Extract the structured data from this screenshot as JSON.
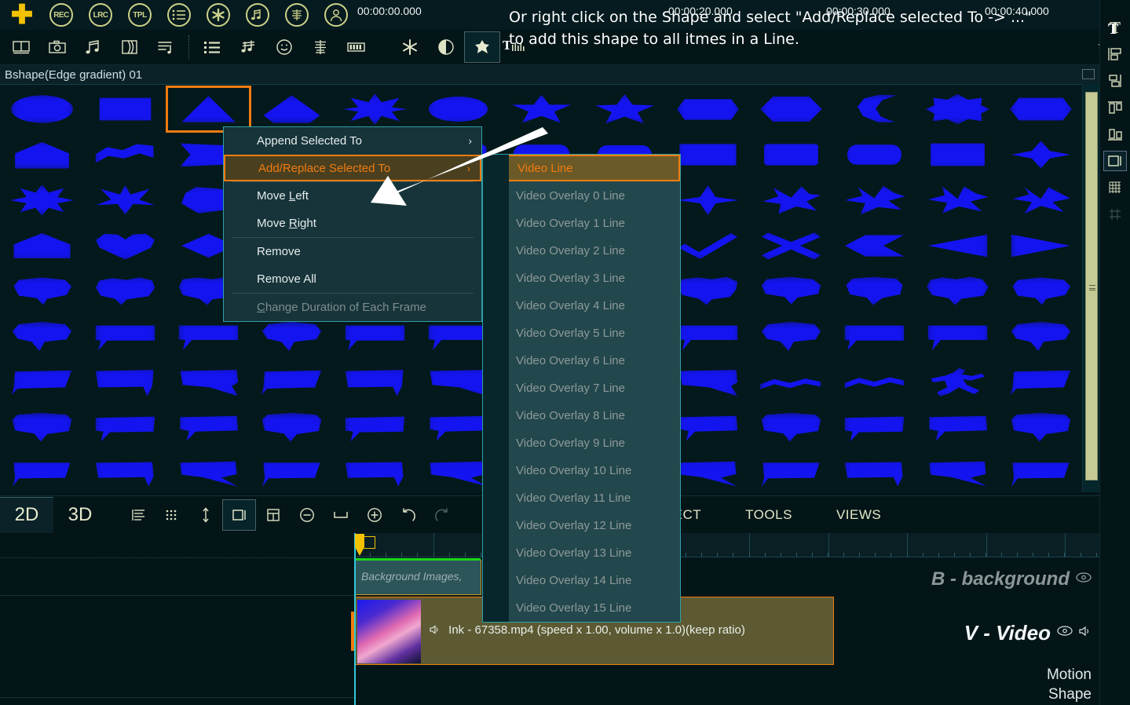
{
  "app": {
    "title": "Bshape(Edge gradient) 01"
  },
  "toolbar_primary": [
    {
      "name": "add-button",
      "label": "+",
      "type": "plus"
    },
    {
      "name": "record-button",
      "label": "REC",
      "type": "circle"
    },
    {
      "name": "lyrics-button",
      "label": "LRC",
      "type": "circle"
    },
    {
      "name": "template-button",
      "label": "TPL",
      "type": "circle"
    },
    {
      "name": "list-button",
      "label": "list-icon",
      "type": "circle-icon"
    },
    {
      "name": "asterisk-button",
      "label": "asterisk-icon",
      "type": "circle-icon"
    },
    {
      "name": "music-note-button",
      "label": "music-note-icon",
      "type": "circle-icon"
    },
    {
      "name": "equalizer-button",
      "label": "equalizer-icon",
      "type": "circle-icon"
    },
    {
      "name": "user-button",
      "label": "user-icon",
      "type": "circle-icon"
    }
  ],
  "toolbar_secondary": [
    {
      "name": "filmstrip-icon",
      "selected": false
    },
    {
      "name": "camera-icon",
      "selected": false
    },
    {
      "name": "music-notes-icon",
      "selected": false
    },
    {
      "name": "transition-icon",
      "selected": false
    },
    {
      "name": "playlist-note-icon",
      "selected": false
    },
    {
      "name": "bullet-list-icon",
      "selected": false
    },
    {
      "name": "sharp-note-icon",
      "selected": false
    },
    {
      "name": "smiley-icon",
      "selected": false
    },
    {
      "name": "equalizer-bars-icon",
      "selected": false
    },
    {
      "name": "battery-icon",
      "selected": false
    },
    {
      "name": "snowflake-icon",
      "selected": false
    },
    {
      "name": "half-circle-icon",
      "selected": false
    },
    {
      "name": "puzzle-shape-icon",
      "selected": true
    },
    {
      "name": "vu-meter-icon",
      "selected": false
    }
  ],
  "export_icon": "download-icon",
  "annotation": {
    "line1": "Or right click on the Shape and select \"Add/Replace selected To -> ...\"",
    "line2": "to add this shape to all itmes in a Line."
  },
  "context_menu": {
    "items": [
      {
        "label": "Append Selected To",
        "state": "normal",
        "submenu": true
      },
      {
        "label": "Add/Replace Selected To",
        "state": "highlighted",
        "submenu": true
      },
      {
        "label": "Move Left",
        "state": "normal",
        "submenu": false,
        "accel": "L"
      },
      {
        "label": "Move Right",
        "state": "normal",
        "submenu": false,
        "accel": "R"
      },
      {
        "label": "Remove",
        "state": "normal",
        "submenu": false
      },
      {
        "label": "Remove All",
        "state": "normal",
        "submenu": false
      },
      {
        "label": "Change Duration of Each Frame",
        "state": "disabled",
        "submenu": false,
        "accel": "C"
      }
    ]
  },
  "submenu": {
    "items": [
      {
        "label": "Video Line",
        "state": "highlighted"
      },
      {
        "label": "Video Overlay 0 Line",
        "state": "disabled"
      },
      {
        "label": "Video Overlay 1 Line",
        "state": "disabled"
      },
      {
        "label": "Video Overlay 2 Line",
        "state": "disabled"
      },
      {
        "label": "Video Overlay 3 Line",
        "state": "disabled"
      },
      {
        "label": "Video Overlay 4 Line",
        "state": "disabled"
      },
      {
        "label": "Video Overlay 5 Line",
        "state": "disabled"
      },
      {
        "label": "Video Overlay 6 Line",
        "state": "disabled"
      },
      {
        "label": "Video Overlay 7 Line",
        "state": "disabled"
      },
      {
        "label": "Video Overlay 8 Line",
        "state": "disabled"
      },
      {
        "label": "Video Overlay 9 Line",
        "state": "disabled"
      },
      {
        "label": "Video Overlay 10 Line",
        "state": "disabled"
      },
      {
        "label": "Video Overlay 11 Line",
        "state": "disabled"
      },
      {
        "label": "Video Overlay 12 Line",
        "state": "disabled"
      },
      {
        "label": "Video Overlay 13 Line",
        "state": "disabled"
      },
      {
        "label": "Video Overlay 14 Line",
        "state": "disabled"
      },
      {
        "label": "Video Overlay 15 Line",
        "state": "disabled"
      }
    ]
  },
  "shape_panel": {
    "selected_index": 2,
    "scroll_thumb": "vertical-scrollbar-thumb"
  },
  "right_sidebar": [
    {
      "name": "text-tool",
      "glyph": "T",
      "state": "normal"
    },
    {
      "name": "align-left-tool",
      "glyph": "align-left-icon",
      "state": "normal"
    },
    {
      "name": "align-center-tool",
      "glyph": "align-center-icon",
      "state": "normal"
    },
    {
      "name": "align-top-tool",
      "glyph": "align-top-icon",
      "state": "normal"
    },
    {
      "name": "align-bottom-tool",
      "glyph": "align-bottom-icon",
      "state": "normal"
    },
    {
      "name": "frame-tool",
      "glyph": "frame-icon",
      "state": "selected"
    },
    {
      "name": "grid-fine-tool",
      "glyph": "grid-fine-icon",
      "state": "normal"
    },
    {
      "name": "grid-coarse-tool",
      "glyph": "grid-coarse-icon",
      "state": "dim"
    }
  ],
  "bottom_toolbar": {
    "tabs": [
      {
        "label": "2D",
        "active": true
      },
      {
        "label": "3D",
        "active": false
      }
    ],
    "icons": [
      {
        "name": "list-lines-icon",
        "selected": false,
        "dim": false
      },
      {
        "name": "dot-grid-icon",
        "selected": false,
        "dim": false
      },
      {
        "name": "vertical-resize-icon",
        "selected": false,
        "dim": false
      },
      {
        "name": "frame-select-icon",
        "selected": true,
        "dim": false
      },
      {
        "name": "table-icon",
        "selected": false,
        "dim": false
      },
      {
        "name": "zoom-out-icon",
        "selected": false,
        "dim": false
      },
      {
        "name": "fit-width-icon",
        "selected": false,
        "dim": false
      },
      {
        "name": "zoom-in-icon",
        "selected": false,
        "dim": false
      },
      {
        "name": "undo-icon",
        "selected": false,
        "dim": false
      },
      {
        "name": "redo-icon",
        "selected": false,
        "dim": true
      }
    ],
    "menus": [
      "EFFECT",
      "TOOLS",
      "VIEWS"
    ]
  },
  "timeline": {
    "ruler_labels": [
      "00:00:00.000",
      "00:00:20.000",
      "00:00:30.000",
      "00:00:40.000"
    ],
    "playhead_position": "00:00:00.000",
    "tracks": [
      {
        "name": "B - background",
        "style": "dim",
        "eye": true,
        "speaker": false
      },
      {
        "name": "V - Video",
        "style": "bright",
        "eye": true,
        "speaker": true
      },
      {
        "name": "Motion",
        "style": "sub",
        "eye": false,
        "speaker": false
      },
      {
        "name": "Shape",
        "style": "sub",
        "eye": false,
        "speaker": false
      }
    ],
    "clips": [
      {
        "name": "background-clip",
        "label": "Background Images,"
      },
      {
        "name": "video-clip",
        "label": "Ink - 67358.mp4  (speed x 1.00, volume x 1.0)(keep ratio)"
      }
    ]
  },
  "colors": {
    "accent_orange": "#f07b10",
    "accent_yellow": "#f2c200",
    "shape_blue": "#1414f0",
    "panel_bg": "#041518",
    "menu_bg": "#16343a",
    "cyan_border": "#2fa0a8"
  }
}
